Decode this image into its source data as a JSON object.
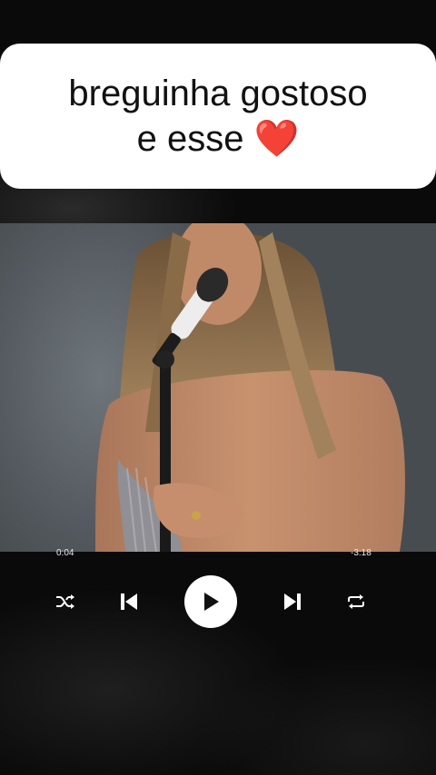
{
  "caption": {
    "line1": "breguinha gostoso",
    "line2_text": "e esse",
    "line2_emoji": "❤️"
  },
  "player": {
    "elapsed": "0:04",
    "remaining": "-3:18",
    "controls": {
      "shuffle": "shuffle-icon",
      "previous": "skip-previous-icon",
      "play": "play-icon",
      "next": "skip-next-icon",
      "repeat": "repeat-icon"
    }
  },
  "colors": {
    "caption_background": "#ffffff",
    "caption_text": "#111111",
    "heart": "#e11d2b",
    "page_background": "#0a0a0a",
    "control_icons": "#ffffff"
  }
}
